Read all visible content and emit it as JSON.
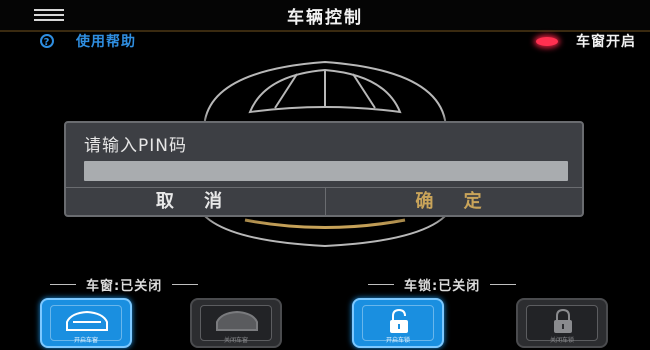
{
  "header": {
    "title": "车辆控制",
    "menu_icon": "hamburger-menu-icon"
  },
  "help": {
    "label": "使用帮助",
    "icon": "help-circle-icon"
  },
  "window_status": {
    "label": "车窗开启",
    "indicator_color": "#ff3050"
  },
  "dialog": {
    "title": "请输入PIN码",
    "input_value": "",
    "cancel_label": "取 消",
    "ok_label": "确 定"
  },
  "status": {
    "window": "车窗:已关闭",
    "lock": "车锁:已关闭"
  },
  "controls": {
    "window_open_label": "开启车窗",
    "window_close_label": "关闭车窗",
    "lock_open_label": "开启车锁",
    "lock_close_label": "关闭车锁"
  },
  "colors": {
    "accent": "#1a8fe0",
    "confirm": "#c9a45a",
    "help": "#2f8ee0"
  }
}
